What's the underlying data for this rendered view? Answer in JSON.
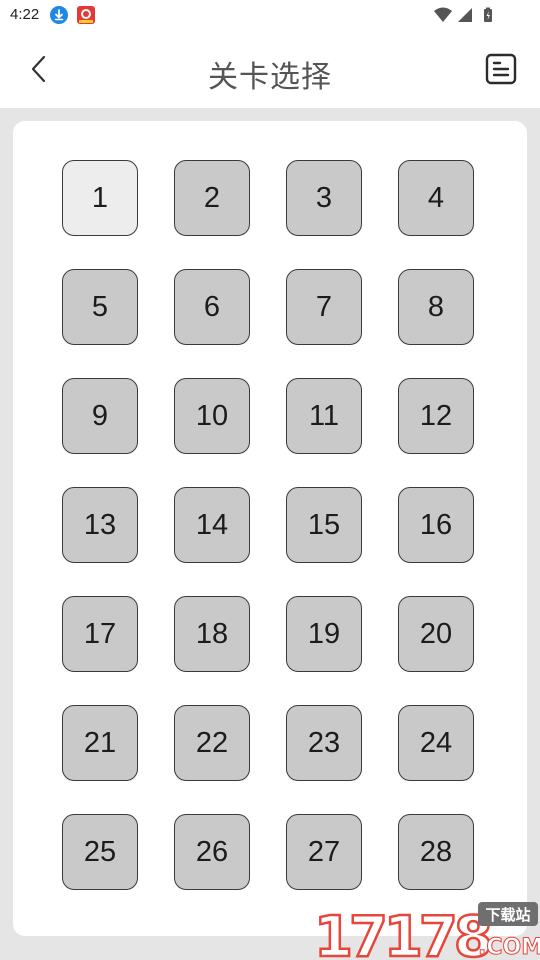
{
  "status_bar": {
    "time": "4:22",
    "icons": [
      "download-notification-icon",
      "app-notification-icon",
      "wifi-icon",
      "signal-icon",
      "battery-icon"
    ]
  },
  "header": {
    "title": "关卡选择",
    "back_icon": "chevron-left-icon",
    "action_icon": "document-icon"
  },
  "levels": {
    "items": [
      {
        "label": "1",
        "state": "unlocked"
      },
      {
        "label": "2",
        "state": "locked"
      },
      {
        "label": "3",
        "state": "locked"
      },
      {
        "label": "4",
        "state": "locked"
      },
      {
        "label": "5",
        "state": "locked"
      },
      {
        "label": "6",
        "state": "locked"
      },
      {
        "label": "7",
        "state": "locked"
      },
      {
        "label": "8",
        "state": "locked"
      },
      {
        "label": "9",
        "state": "locked"
      },
      {
        "label": "10",
        "state": "locked"
      },
      {
        "label": "11",
        "state": "locked"
      },
      {
        "label": "12",
        "state": "locked"
      },
      {
        "label": "13",
        "state": "locked"
      },
      {
        "label": "14",
        "state": "locked"
      },
      {
        "label": "15",
        "state": "locked"
      },
      {
        "label": "16",
        "state": "locked"
      },
      {
        "label": "17",
        "state": "locked"
      },
      {
        "label": "18",
        "state": "locked"
      },
      {
        "label": "19",
        "state": "locked"
      },
      {
        "label": "20",
        "state": "locked"
      },
      {
        "label": "21",
        "state": "locked"
      },
      {
        "label": "22",
        "state": "locked"
      },
      {
        "label": "23",
        "state": "locked"
      },
      {
        "label": "24",
        "state": "locked"
      },
      {
        "label": "25",
        "state": "locked"
      },
      {
        "label": "26",
        "state": "locked"
      },
      {
        "label": "27",
        "state": "locked"
      },
      {
        "label": "28",
        "state": "locked"
      }
    ]
  },
  "watermark": {
    "number": "17178",
    "tag": "下载站",
    "domain": ".COM"
  },
  "colors": {
    "unlocked_cell": "#ededed",
    "locked_cell": "#c9c9c9",
    "page_background": "#e5e5e5",
    "watermark_red": "#e7463b"
  }
}
